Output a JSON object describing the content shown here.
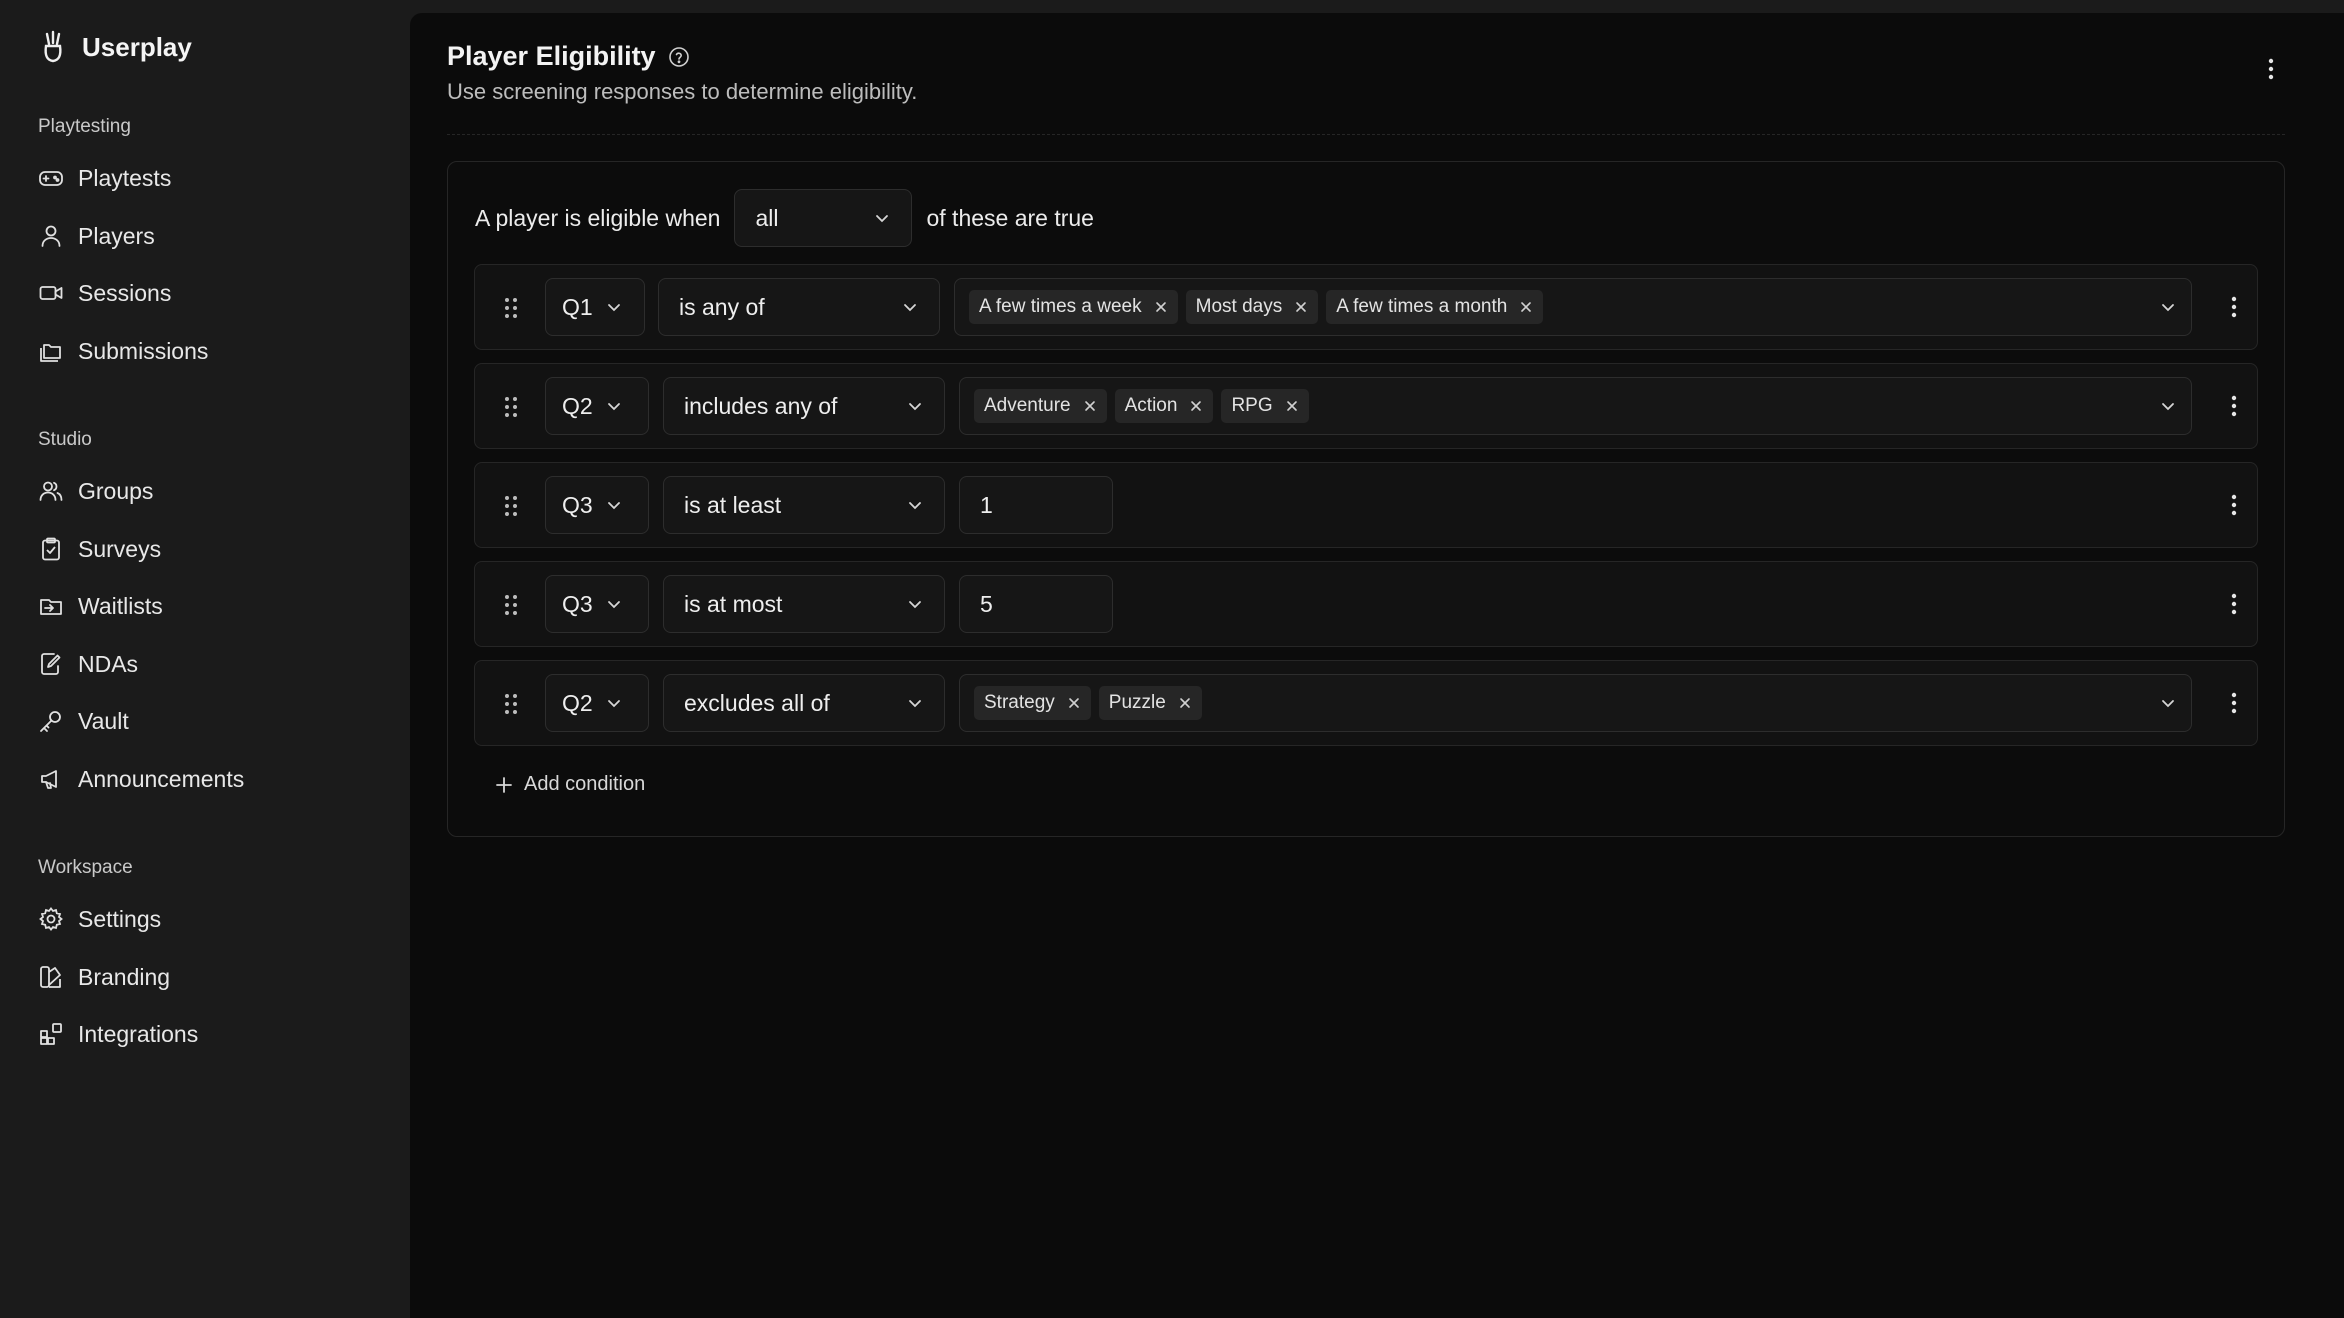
{
  "brand": {
    "name": "Userplay",
    "icon": "userplay-logo"
  },
  "sidebar": {
    "sections": [
      {
        "heading": "Playtesting",
        "items": [
          {
            "label": "Playtests",
            "icon": "gamepad-icon"
          },
          {
            "label": "Players",
            "icon": "user-icon"
          },
          {
            "label": "Sessions",
            "icon": "video-camera-icon"
          },
          {
            "label": "Submissions",
            "icon": "folders-icon"
          }
        ]
      },
      {
        "heading": "Studio",
        "items": [
          {
            "label": "Groups",
            "icon": "users-icon"
          },
          {
            "label": "Surveys",
            "icon": "clipboard-icon"
          },
          {
            "label": "Waitlists",
            "icon": "waitlist-icon"
          },
          {
            "label": "NDAs",
            "icon": "document-edit-icon"
          },
          {
            "label": "Vault",
            "icon": "key-icon"
          },
          {
            "label": "Announcements",
            "icon": "megaphone-icon"
          }
        ]
      },
      {
        "heading": "Workspace",
        "items": [
          {
            "label": "Settings",
            "icon": "gear-icon"
          },
          {
            "label": "Branding",
            "icon": "palette-icon"
          },
          {
            "label": "Integrations",
            "icon": "integrations-icon"
          }
        ]
      }
    ]
  },
  "header": {
    "title": "Player Eligibility",
    "subtitle": "Use screening responses to determine eligibility."
  },
  "rule": {
    "prefix": "A player is eligible when",
    "match": "all",
    "suffix": "of these are true"
  },
  "conditions": [
    {
      "question": "Q1",
      "operator": "is any of",
      "values": [
        "A few times a week",
        "Most days",
        "A few times a month"
      ]
    },
    {
      "question": "Q2",
      "operator": "includes any of",
      "values": [
        "Adventure",
        "Action",
        "RPG"
      ]
    },
    {
      "question": "Q3",
      "operator": "is at least",
      "number": "1"
    },
    {
      "question": "Q3",
      "operator": "is at most",
      "number": "5"
    },
    {
      "question": "Q2",
      "operator": "excludes all of",
      "values": [
        "Strategy",
        "Puzzle"
      ]
    }
  ],
  "add_condition_label": "Add condition",
  "colors": {
    "background": "#0b0b0b",
    "sidebar": "#1b1b1b",
    "chip": "#262626",
    "border": "#2d2d2d"
  }
}
